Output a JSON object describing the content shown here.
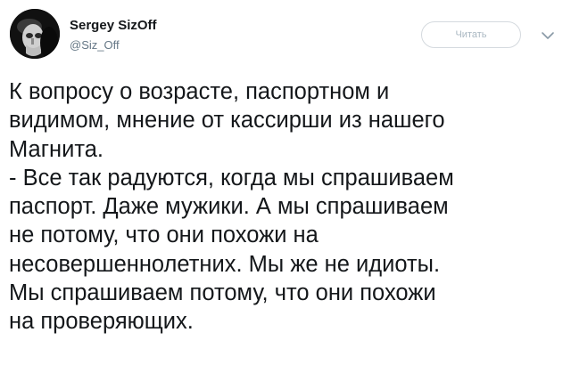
{
  "user": {
    "display_name": "Sergey SizOff",
    "username": "@Siz_Off",
    "avatar": "portrait-avatar"
  },
  "actions": {
    "follow_label": "Читать",
    "menu_icon": "chevron-down-icon"
  },
  "tweet": {
    "lines": [
      "К вопросу о возрасте, паспортном и",
      "видимом, мнение от кассирши из нашего",
      "Магнита.",
      "- Все так радуются, когда мы спрашиваем",
      "паспорт. Даже мужики. А мы спрашиваем",
      "не потому, что они похожи на",
      "несовершеннолетних. Мы же не идиоты.",
      "Мы спрашиваем потому, что они похожи",
      "на проверяющих."
    ]
  },
  "colors": {
    "text": "#14171a",
    "muted": "#657786",
    "button_border": "#d4d9de",
    "button_text": "#aab8c2"
  }
}
